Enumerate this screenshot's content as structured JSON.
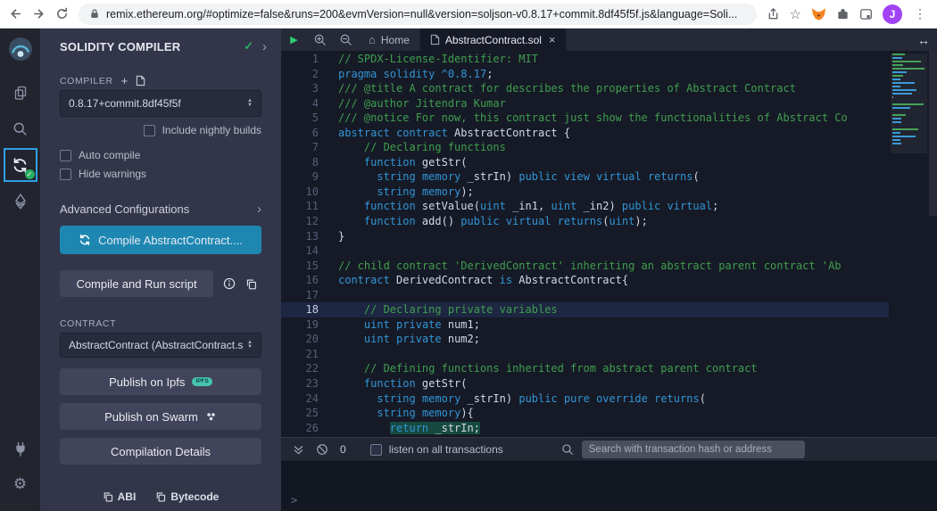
{
  "browser": {
    "url": "remix.ethereum.org/#optimize=false&runs=200&evmVersion=null&version=soljson-v0.8.17+commit.8df45f5f.js&language=Soli...",
    "avatar_initial": "J"
  },
  "icons": {
    "check": "✓",
    "chevron": "›",
    "plus": "+",
    "up": "▲",
    "down": "▼",
    "close": "×",
    "menu_dots": "⋮",
    "star": "☆",
    "home": "⌂",
    "play": "▶",
    "resize": "↔",
    "gear": "⚙"
  },
  "panel": {
    "title": "SOLIDITY COMPILER",
    "compiler_label": "COMPILER",
    "compiler_version": "0.8.17+commit.8df45f5f",
    "include_nightly_label": "Include nightly builds",
    "auto_compile_label": "Auto compile",
    "hide_warnings_label": "Hide warnings",
    "advanced_label": "Advanced Configurations",
    "compile_button_label": "Compile AbstractContract....",
    "compile_run_label": "Compile and Run script",
    "contract_label": "CONTRACT",
    "contract_value": "AbstractContract (AbstractContract.s",
    "publish_ipfs_label": "Publish on Ipfs",
    "ipfs_badge": "IPFS",
    "publish_swarm_label": "Publish on Swarm",
    "compilation_details_label": "Compilation Details",
    "abi_label": "ABI",
    "bytecode_label": "Bytecode"
  },
  "tabbar": {
    "home_tab": "Home",
    "file_tab": "AbstractContract.sol"
  },
  "editor": {
    "lines": [
      {
        "n": 1,
        "t": [
          [
            "c",
            "// SPDX-License-Identifier: MIT"
          ]
        ]
      },
      {
        "n": 2,
        "t": [
          [
            "k",
            "pragma solidity"
          ],
          [
            "p",
            " "
          ],
          [
            "k",
            "^0.8.17"
          ],
          [
            "p",
            ";"
          ]
        ]
      },
      {
        "n": 3,
        "t": [
          [
            "c",
            "/// @title A contract for describes the properties of Abstract Contract"
          ]
        ]
      },
      {
        "n": 4,
        "t": [
          [
            "c",
            "/// @author Jitendra Kumar"
          ]
        ]
      },
      {
        "n": 5,
        "t": [
          [
            "c",
            "/// @notice For now, this contract just show the functionalities of Abstract Co"
          ]
        ]
      },
      {
        "n": 6,
        "t": [
          [
            "k",
            "abstract"
          ],
          [
            "p",
            " "
          ],
          [
            "k",
            "contract"
          ],
          [
            "p",
            " AbstractContract {"
          ]
        ]
      },
      {
        "n": 7,
        "t": [
          [
            "p",
            "    "
          ],
          [
            "c",
            "// Declaring functions"
          ]
        ]
      },
      {
        "n": 8,
        "t": [
          [
            "p",
            "    "
          ],
          [
            "k",
            "function"
          ],
          [
            "p",
            " getStr("
          ]
        ]
      },
      {
        "n": 9,
        "t": [
          [
            "p",
            "      "
          ],
          [
            "k",
            "string"
          ],
          [
            "p",
            " "
          ],
          [
            "k",
            "memory"
          ],
          [
            "p",
            " _strIn) "
          ],
          [
            "k",
            "public"
          ],
          [
            "p",
            " "
          ],
          [
            "k",
            "view"
          ],
          [
            "p",
            " "
          ],
          [
            "k",
            "virtual"
          ],
          [
            "p",
            " "
          ],
          [
            "k",
            "returns"
          ],
          [
            "p",
            "("
          ]
        ]
      },
      {
        "n": 10,
        "t": [
          [
            "p",
            "      "
          ],
          [
            "k",
            "string"
          ],
          [
            "p",
            " "
          ],
          [
            "k",
            "memory"
          ],
          [
            "p",
            ");"
          ]
        ]
      },
      {
        "n": 11,
        "t": [
          [
            "p",
            "    "
          ],
          [
            "k",
            "function"
          ],
          [
            "p",
            " setValue("
          ],
          [
            "k",
            "uint"
          ],
          [
            "p",
            " _in1, "
          ],
          [
            "k",
            "uint"
          ],
          [
            "p",
            " _in2) "
          ],
          [
            "k",
            "public"
          ],
          [
            "p",
            " "
          ],
          [
            "k",
            "virtual"
          ],
          [
            "p",
            ";"
          ]
        ]
      },
      {
        "n": 12,
        "t": [
          [
            "p",
            "    "
          ],
          [
            "k",
            "function"
          ],
          [
            "p",
            " add() "
          ],
          [
            "k",
            "public"
          ],
          [
            "p",
            " "
          ],
          [
            "k",
            "virtual"
          ],
          [
            "p",
            " "
          ],
          [
            "k",
            "returns"
          ],
          [
            "p",
            "("
          ],
          [
            "k",
            "uint"
          ],
          [
            "p",
            ");"
          ]
        ]
      },
      {
        "n": 13,
        "t": [
          [
            "p",
            "}"
          ]
        ]
      },
      {
        "n": 14,
        "t": []
      },
      {
        "n": 15,
        "t": [
          [
            "c",
            "// child contract 'DerivedContract' inheriting an abstract parent contract 'Ab"
          ]
        ]
      },
      {
        "n": 16,
        "t": [
          [
            "k",
            "contract"
          ],
          [
            "p",
            " DerivedContract "
          ],
          [
            "k",
            "is"
          ],
          [
            "p",
            " AbstractContract{"
          ]
        ]
      },
      {
        "n": 17,
        "t": []
      },
      {
        "n": 18,
        "hl": true,
        "t": [
          [
            "p",
            "    "
          ],
          [
            "c",
            "// Declaring private variables"
          ]
        ]
      },
      {
        "n": 19,
        "t": [
          [
            "p",
            "    "
          ],
          [
            "k",
            "uint"
          ],
          [
            "p",
            " "
          ],
          [
            "k",
            "private"
          ],
          [
            "p",
            " num1;"
          ]
        ]
      },
      {
        "n": 20,
        "t": [
          [
            "p",
            "    "
          ],
          [
            "k",
            "uint"
          ],
          [
            "p",
            " "
          ],
          [
            "k",
            "private"
          ],
          [
            "p",
            " num2;"
          ]
        ]
      },
      {
        "n": 21,
        "t": []
      },
      {
        "n": 22,
        "t": [
          [
            "p",
            "    "
          ],
          [
            "c",
            "// Defining functions inherited from abstract parent contract"
          ]
        ]
      },
      {
        "n": 23,
        "t": [
          [
            "p",
            "    "
          ],
          [
            "k",
            "function"
          ],
          [
            "p",
            " getStr("
          ]
        ]
      },
      {
        "n": 24,
        "t": [
          [
            "p",
            "      "
          ],
          [
            "k",
            "string"
          ],
          [
            "p",
            " "
          ],
          [
            "k",
            "memory"
          ],
          [
            "p",
            " _strIn) "
          ],
          [
            "k",
            "public"
          ],
          [
            "p",
            " "
          ],
          [
            "k",
            "pure"
          ],
          [
            "p",
            " "
          ],
          [
            "k",
            "override"
          ],
          [
            "p",
            " "
          ],
          [
            "k",
            "returns"
          ],
          [
            "p",
            "("
          ]
        ]
      },
      {
        "n": 25,
        "t": [
          [
            "p",
            "      "
          ],
          [
            "k",
            "string"
          ],
          [
            "p",
            " "
          ],
          [
            "k",
            "memory"
          ],
          [
            "p",
            "){"
          ]
        ]
      },
      {
        "n": 26,
        "t": [
          [
            "p",
            "        "
          ],
          [
            "k",
            "return",
            "sel"
          ],
          [
            "p",
            " _strIn;",
            "sel"
          ]
        ]
      }
    ]
  },
  "terminal": {
    "count": "0",
    "listen_label": "listen on all transactions",
    "search_placeholder": "Search with transaction hash or address",
    "prompt": ">"
  },
  "colors": {
    "keyword": "#3195d6",
    "comment": "#3f9e4f",
    "plain": "#8a8fa3",
    "accent_blue": "#1d87b2",
    "success_green": "#27ae60",
    "rail_active_border": "#2f9fe5"
  }
}
